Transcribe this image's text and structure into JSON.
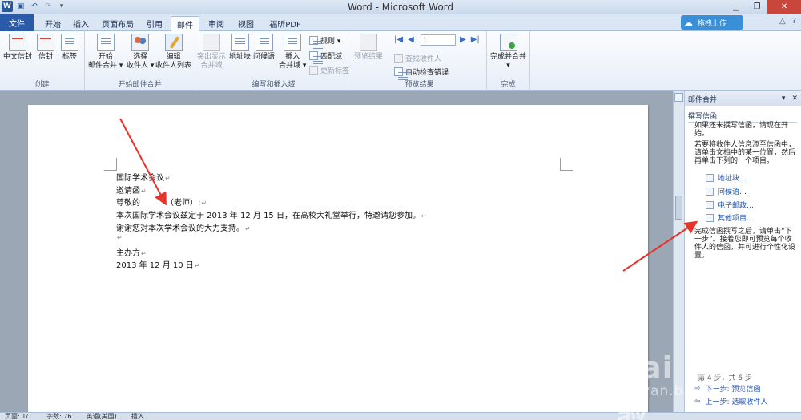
{
  "window": {
    "title": "Word - Microsoft Word",
    "app_icon": "W",
    "qat": {
      "save_icon": "save-icon",
      "undo_icon": "undo-icon",
      "redo_icon": "redo-icon"
    }
  },
  "tabs": [
    {
      "label": "文件"
    },
    {
      "label": "开始"
    },
    {
      "label": "插入"
    },
    {
      "label": "页面布局"
    },
    {
      "label": "引用"
    },
    {
      "label": "邮件"
    },
    {
      "label": "审阅"
    },
    {
      "label": "视图"
    },
    {
      "label": "福昕PDF"
    }
  ],
  "active_tab": "邮件",
  "upload_button": "拖拽上传",
  "ribbon": {
    "create": {
      "label": "创建",
      "chinese_envelope": "中文信封",
      "envelope": "信封",
      "labels": "标签"
    },
    "start_merge": {
      "label": "开始邮件合并",
      "start": [
        "开始",
        "邮件合并 ▾"
      ],
      "select": [
        "选择",
        "收件人 ▾"
      ],
      "edit": [
        "编辑",
        "收件人列表"
      ]
    },
    "write_insert": {
      "label": "编写和插入域",
      "highlight": [
        "突出显示",
        "合并域"
      ],
      "address_block": "地址块",
      "greeting_line": "问候语",
      "insert_field": [
        "插入",
        "合并域 ▾"
      ],
      "rules": "规则 ▾",
      "match_fields": "匹配域",
      "update_labels": "更新标签"
    },
    "preview": {
      "label": "预览结果",
      "preview_results": "预览结果",
      "record": "1",
      "find_recipient": "查找收件人",
      "auto_check": "自动检查错误"
    },
    "finish": {
      "label": "完成",
      "finish_merge": [
        "完成并合并",
        "▾"
      ]
    }
  },
  "document": {
    "lines": [
      "国际学术会议",
      "邀请函",
      "尊敬的",
      "（老师）:",
      "本次国际学术会议兹定于 2013 年 12 月 15 日，在高校大礼堂举行，特邀请您参加。",
      "谢谢您对本次学术会议的大力支持。",
      "",
      "主办方",
      "2013 年 12 月 10 日"
    ],
    "paragraph_mark": "↵"
  },
  "taskpane": {
    "title": "邮件合并",
    "section": "撰写信函",
    "intro1": "如果还未撰写信函，请现在开始。",
    "intro2": "若要将收件人信息添至信函中，请单击文档中的某一位置，然后再单击下列的一个项目。",
    "links": [
      "地址块…",
      "问候语…",
      "电子邮政…",
      "其他项目…"
    ],
    "outro": "完成信函撰写之后，请单击“下一步”。接着您即可预览每个收件人的信函，并可进行个性化设置。",
    "step_label": "第 4 步，共 6 步",
    "next_step": "下一步: 预览信函",
    "prev_step": "上一步: 选取收件人"
  },
  "statusbar": {
    "page": "页面: 1/1",
    "words": "字数: 76",
    "language": "英语(美国)",
    "mode": "插入"
  },
  "watermark": {
    "logo": "Bai du 经验",
    "url": "jingyan.baidu.com"
  }
}
